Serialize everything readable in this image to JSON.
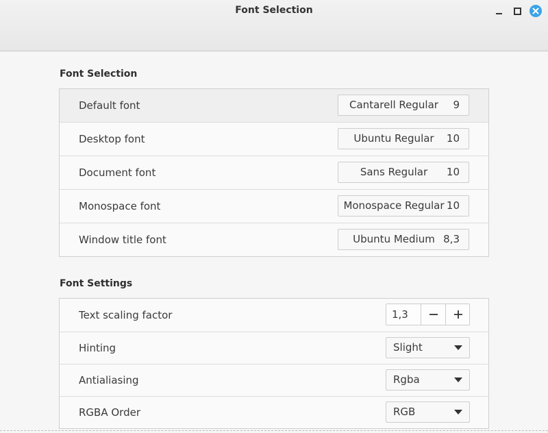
{
  "window": {
    "title": "Font Selection",
    "controls": [
      "minimize-icon",
      "maximize-icon",
      "close-icon"
    ],
    "accent": "#3ba3e8"
  },
  "font_selection": {
    "heading": "Font Selection",
    "rows": [
      {
        "label": "Default font",
        "font": "Cantarell Regular",
        "size": "9"
      },
      {
        "label": "Desktop font",
        "font": "Ubuntu Regular",
        "size": "10"
      },
      {
        "label": "Document font",
        "font": "Sans Regular",
        "size": "10"
      },
      {
        "label": "Monospace font",
        "font": "Monospace Regular",
        "size": "10"
      },
      {
        "label": "Window title font",
        "font": "Ubuntu Medium",
        "size": "8,3"
      }
    ]
  },
  "font_settings": {
    "heading": "Font Settings",
    "scaling": {
      "label": "Text scaling factor",
      "value": "1,3"
    },
    "hinting": {
      "label": "Hinting",
      "value": "Slight"
    },
    "antialiasing": {
      "label": "Antialiasing",
      "value": "Rgba"
    },
    "rgba_order": {
      "label": "RGBA Order",
      "value": "RGB"
    }
  }
}
